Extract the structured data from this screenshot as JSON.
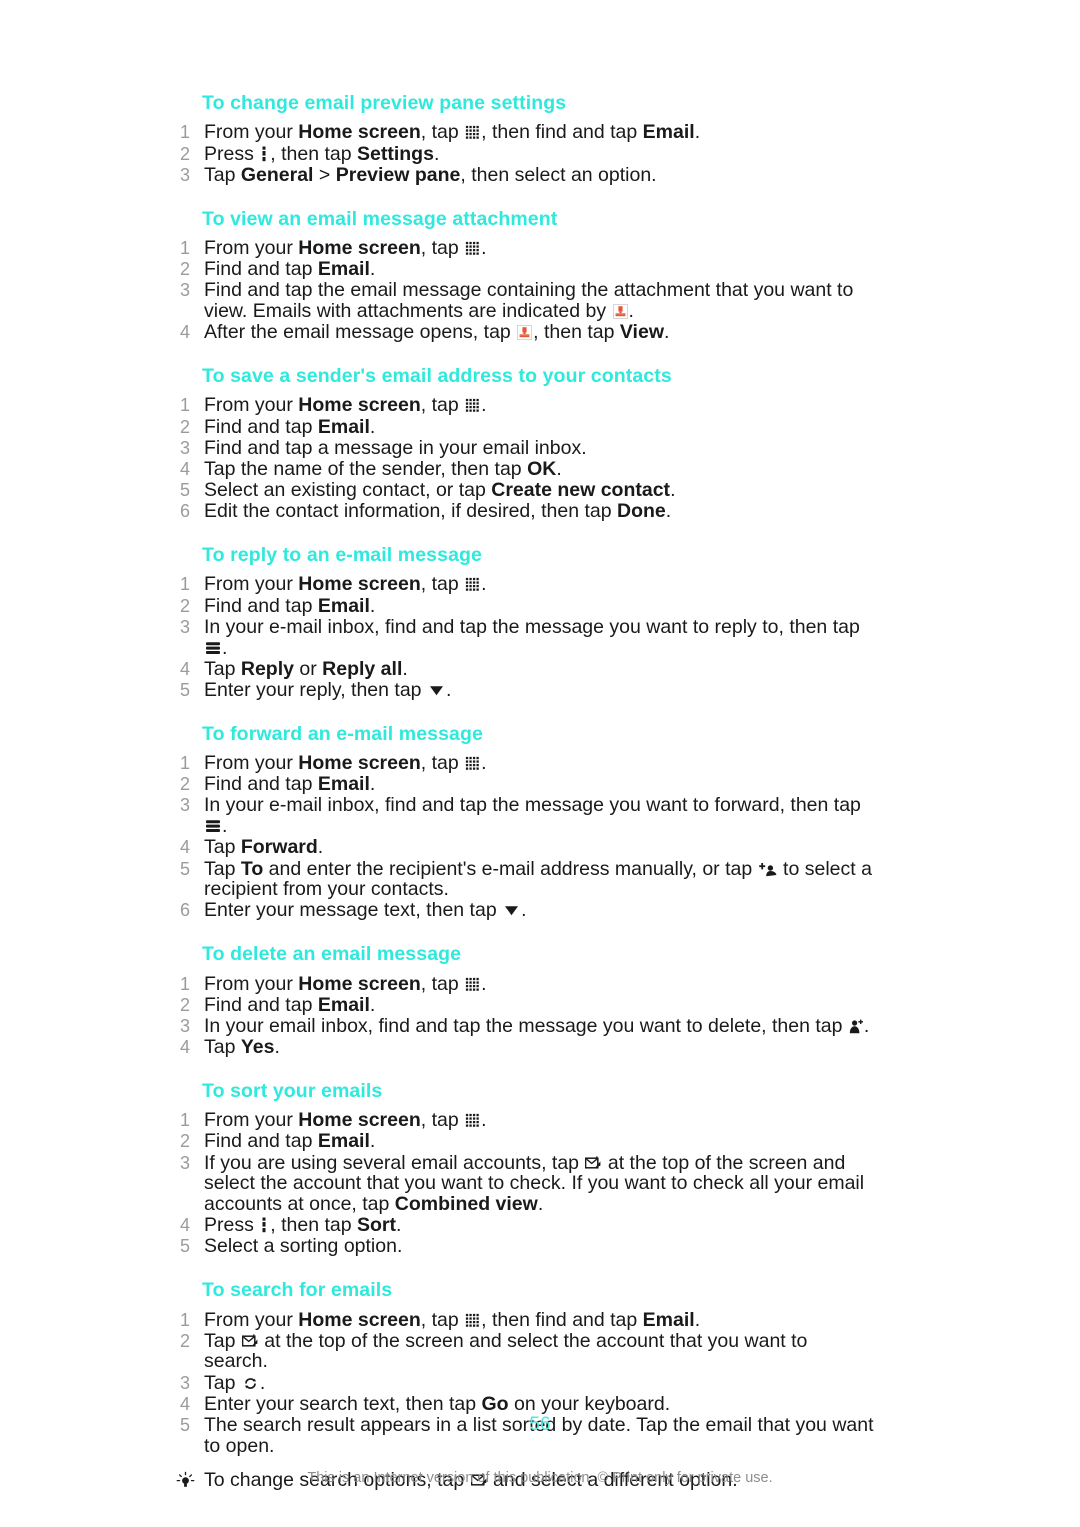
{
  "document": {
    "page_number": "56",
    "footer_note": "This is an Internet version of this publication. © Print only for private use.",
    "heading_color": "#2fe9dc",
    "attachment_icon_color": "#e8563a"
  },
  "sections": [
    {
      "id": "change-preview-pane",
      "title": "To change email preview pane settings",
      "steps": [
        {
          "parts": [
            {
              "t": "text",
              "v": "From your "
            },
            {
              "t": "bold",
              "v": "Home screen"
            },
            {
              "t": "text",
              "v": ", tap "
            },
            {
              "t": "icon",
              "v": "app-grid-icon"
            },
            {
              "t": "text",
              "v": ", then find and tap "
            },
            {
              "t": "bold",
              "v": "Email"
            },
            {
              "t": "text",
              "v": "."
            }
          ]
        },
        {
          "parts": [
            {
              "t": "text",
              "v": "Press "
            },
            {
              "t": "icon",
              "v": "vertical-menu-icon"
            },
            {
              "t": "text",
              "v": ", then tap "
            },
            {
              "t": "bold",
              "v": "Settings"
            },
            {
              "t": "text",
              "v": "."
            }
          ]
        },
        {
          "parts": [
            {
              "t": "text",
              "v": "Tap "
            },
            {
              "t": "bold",
              "v": "General"
            },
            {
              "t": "text",
              "v": " > "
            },
            {
              "t": "bold",
              "v": "Preview pane"
            },
            {
              "t": "text",
              "v": ", then select an option."
            }
          ]
        }
      ]
    },
    {
      "id": "view-attachment",
      "title": "To view an email message attachment",
      "steps": [
        {
          "parts": [
            {
              "t": "text",
              "v": "From your "
            },
            {
              "t": "bold",
              "v": "Home screen"
            },
            {
              "t": "text",
              "v": ", tap "
            },
            {
              "t": "icon",
              "v": "app-grid-icon"
            },
            {
              "t": "text",
              "v": "."
            }
          ]
        },
        {
          "parts": [
            {
              "t": "text",
              "v": "Find and tap "
            },
            {
              "t": "bold",
              "v": "Email"
            },
            {
              "t": "text",
              "v": "."
            }
          ]
        },
        {
          "parts": [
            {
              "t": "text",
              "v": "Find and tap the email message containing the attachment that you want to view. Emails with attachments are indicated by "
            },
            {
              "t": "icon",
              "v": "attachment-icon"
            },
            {
              "t": "text",
              "v": "."
            }
          ]
        },
        {
          "parts": [
            {
              "t": "text",
              "v": "After the email message opens, tap "
            },
            {
              "t": "icon",
              "v": "attachment-icon"
            },
            {
              "t": "text",
              "v": ", then tap "
            },
            {
              "t": "bold",
              "v": "View"
            },
            {
              "t": "text",
              "v": "."
            }
          ]
        }
      ]
    },
    {
      "id": "save-sender-address",
      "title": "To save a sender's email address to your contacts",
      "steps": [
        {
          "parts": [
            {
              "t": "text",
              "v": "From your "
            },
            {
              "t": "bold",
              "v": "Home screen"
            },
            {
              "t": "text",
              "v": ", tap "
            },
            {
              "t": "icon",
              "v": "app-grid-icon"
            },
            {
              "t": "text",
              "v": "."
            }
          ]
        },
        {
          "parts": [
            {
              "t": "text",
              "v": "Find and tap "
            },
            {
              "t": "bold",
              "v": "Email"
            },
            {
              "t": "text",
              "v": "."
            }
          ]
        },
        {
          "parts": [
            {
              "t": "text",
              "v": "Find and tap a message in your email inbox."
            }
          ]
        },
        {
          "parts": [
            {
              "t": "text",
              "v": "Tap the name of the sender, then tap "
            },
            {
              "t": "bold",
              "v": "OK"
            },
            {
              "t": "text",
              "v": "."
            }
          ]
        },
        {
          "parts": [
            {
              "t": "text",
              "v": "Select an existing contact, or tap "
            },
            {
              "t": "bold",
              "v": "Create new contact"
            },
            {
              "t": "text",
              "v": "."
            }
          ]
        },
        {
          "parts": [
            {
              "t": "text",
              "v": "Edit the contact information, if desired, then tap "
            },
            {
              "t": "bold",
              "v": "Done"
            },
            {
              "t": "text",
              "v": "."
            }
          ]
        }
      ]
    },
    {
      "id": "reply-email",
      "title": "To reply to an e-mail message",
      "steps": [
        {
          "parts": [
            {
              "t": "text",
              "v": "From your "
            },
            {
              "t": "bold",
              "v": "Home screen"
            },
            {
              "t": "text",
              "v": ", tap "
            },
            {
              "t": "icon",
              "v": "app-grid-icon"
            },
            {
              "t": "text",
              "v": "."
            }
          ]
        },
        {
          "parts": [
            {
              "t": "text",
              "v": "Find and tap "
            },
            {
              "t": "bold",
              "v": "Email"
            },
            {
              "t": "text",
              "v": "."
            }
          ]
        },
        {
          "parts": [
            {
              "t": "text",
              "v": "In your e-mail inbox, find and tap the message you want to reply to, then tap "
            },
            {
              "t": "icon",
              "v": "list-menu-icon"
            },
            {
              "t": "text",
              "v": "."
            }
          ]
        },
        {
          "parts": [
            {
              "t": "text",
              "v": "Tap "
            },
            {
              "t": "bold",
              "v": "Reply"
            },
            {
              "t": "text",
              "v": " or "
            },
            {
              "t": "bold",
              "v": "Reply all"
            },
            {
              "t": "text",
              "v": "."
            }
          ]
        },
        {
          "parts": [
            {
              "t": "text",
              "v": "Enter your reply, then tap "
            },
            {
              "t": "icon",
              "v": "send-icon"
            },
            {
              "t": "text",
              "v": "."
            }
          ]
        }
      ]
    },
    {
      "id": "forward-email",
      "title": "To forward an e-mail message",
      "steps": [
        {
          "parts": [
            {
              "t": "text",
              "v": "From your "
            },
            {
              "t": "bold",
              "v": "Home screen"
            },
            {
              "t": "text",
              "v": ", tap "
            },
            {
              "t": "icon",
              "v": "app-grid-icon"
            },
            {
              "t": "text",
              "v": "."
            }
          ]
        },
        {
          "parts": [
            {
              "t": "text",
              "v": "Find and tap "
            },
            {
              "t": "bold",
              "v": "Email"
            },
            {
              "t": "text",
              "v": "."
            }
          ]
        },
        {
          "parts": [
            {
              "t": "text",
              "v": "In your e-mail inbox, find and tap the message you want to forward, then tap "
            },
            {
              "t": "icon",
              "v": "list-menu-icon"
            },
            {
              "t": "text",
              "v": "."
            }
          ]
        },
        {
          "parts": [
            {
              "t": "text",
              "v": "Tap "
            },
            {
              "t": "bold",
              "v": "Forward"
            },
            {
              "t": "text",
              "v": "."
            }
          ]
        },
        {
          "parts": [
            {
              "t": "text",
              "v": "Tap "
            },
            {
              "t": "bold",
              "v": "To"
            },
            {
              "t": "text",
              "v": " and enter the recipient's e-mail address manually, or tap "
            },
            {
              "t": "icon",
              "v": "add-contact-icon"
            },
            {
              "t": "text",
              "v": " to select a recipient from your contacts."
            }
          ]
        },
        {
          "parts": [
            {
              "t": "text",
              "v": "Enter your message text, then tap "
            },
            {
              "t": "icon",
              "v": "send-icon"
            },
            {
              "t": "text",
              "v": "."
            }
          ]
        }
      ]
    },
    {
      "id": "delete-email",
      "title": "To delete an email message",
      "steps": [
        {
          "parts": [
            {
              "t": "text",
              "v": "From your "
            },
            {
              "t": "bold",
              "v": "Home screen"
            },
            {
              "t": "text",
              "v": ", tap "
            },
            {
              "t": "icon",
              "v": "app-grid-icon"
            },
            {
              "t": "text",
              "v": "."
            }
          ]
        },
        {
          "parts": [
            {
              "t": "text",
              "v": "Find and tap "
            },
            {
              "t": "bold",
              "v": "Email"
            },
            {
              "t": "text",
              "v": "."
            }
          ]
        },
        {
          "parts": [
            {
              "t": "text",
              "v": "In your email inbox, find and tap the message you want to delete, then tap "
            },
            {
              "t": "icon",
              "v": "delete-icon"
            },
            {
              "t": "text",
              "v": "."
            }
          ]
        },
        {
          "parts": [
            {
              "t": "text",
              "v": "Tap "
            },
            {
              "t": "bold",
              "v": "Yes"
            },
            {
              "t": "text",
              "v": "."
            }
          ]
        }
      ]
    },
    {
      "id": "sort-emails",
      "title": "To sort your emails",
      "steps": [
        {
          "parts": [
            {
              "t": "text",
              "v": "From your "
            },
            {
              "t": "bold",
              "v": "Home screen"
            },
            {
              "t": "text",
              "v": ", tap "
            },
            {
              "t": "icon",
              "v": "app-grid-icon"
            },
            {
              "t": "text",
              "v": "."
            }
          ]
        },
        {
          "parts": [
            {
              "t": "text",
              "v": "Find and tap "
            },
            {
              "t": "bold",
              "v": "Email"
            },
            {
              "t": "text",
              "v": "."
            }
          ]
        },
        {
          "parts": [
            {
              "t": "text",
              "v": "If you are using several email accounts, tap "
            },
            {
              "t": "icon",
              "v": "account-selector-icon"
            },
            {
              "t": "text",
              "v": " at the top of the screen and select the account that you want to check. If you want to check all your email accounts at once, tap "
            },
            {
              "t": "bold",
              "v": "Combined view"
            },
            {
              "t": "text",
              "v": "."
            }
          ]
        },
        {
          "parts": [
            {
              "t": "text",
              "v": "Press "
            },
            {
              "t": "icon",
              "v": "vertical-menu-icon"
            },
            {
              "t": "text",
              "v": ", then tap "
            },
            {
              "t": "bold",
              "v": "Sort"
            },
            {
              "t": "text",
              "v": "."
            }
          ]
        },
        {
          "parts": [
            {
              "t": "text",
              "v": "Select a sorting option."
            }
          ]
        }
      ]
    },
    {
      "id": "search-emails",
      "title": "To search for emails",
      "steps": [
        {
          "parts": [
            {
              "t": "text",
              "v": "From your "
            },
            {
              "t": "bold",
              "v": "Home screen"
            },
            {
              "t": "text",
              "v": ", tap "
            },
            {
              "t": "icon",
              "v": "app-grid-icon"
            },
            {
              "t": "text",
              "v": ", then find and tap "
            },
            {
              "t": "bold",
              "v": "Email"
            },
            {
              "t": "text",
              "v": "."
            }
          ]
        },
        {
          "parts": [
            {
              "t": "text",
              "v": "Tap "
            },
            {
              "t": "icon",
              "v": "account-selector-icon"
            },
            {
              "t": "text",
              "v": " at the top of the screen and select the account that you want to search."
            }
          ]
        },
        {
          "parts": [
            {
              "t": "text",
              "v": "Tap "
            },
            {
              "t": "icon",
              "v": "refresh-icon"
            },
            {
              "t": "text",
              "v": "."
            }
          ]
        },
        {
          "parts": [
            {
              "t": "text",
              "v": "Enter your search text, then tap "
            },
            {
              "t": "bold",
              "v": "Go"
            },
            {
              "t": "text",
              "v": " on your keyboard."
            }
          ]
        },
        {
          "parts": [
            {
              "t": "text",
              "v": "The search result appears in a list sorted by date. Tap the email that you want to open."
            }
          ]
        }
      ],
      "tip": {
        "icon": "lightbulb-icon",
        "parts": [
          {
            "t": "text",
            "v": "To change search options, tap "
          },
          {
            "t": "icon",
            "v": "account-selector-icon"
          },
          {
            "t": "text",
            "v": " and select a different option."
          }
        ]
      }
    }
  ]
}
